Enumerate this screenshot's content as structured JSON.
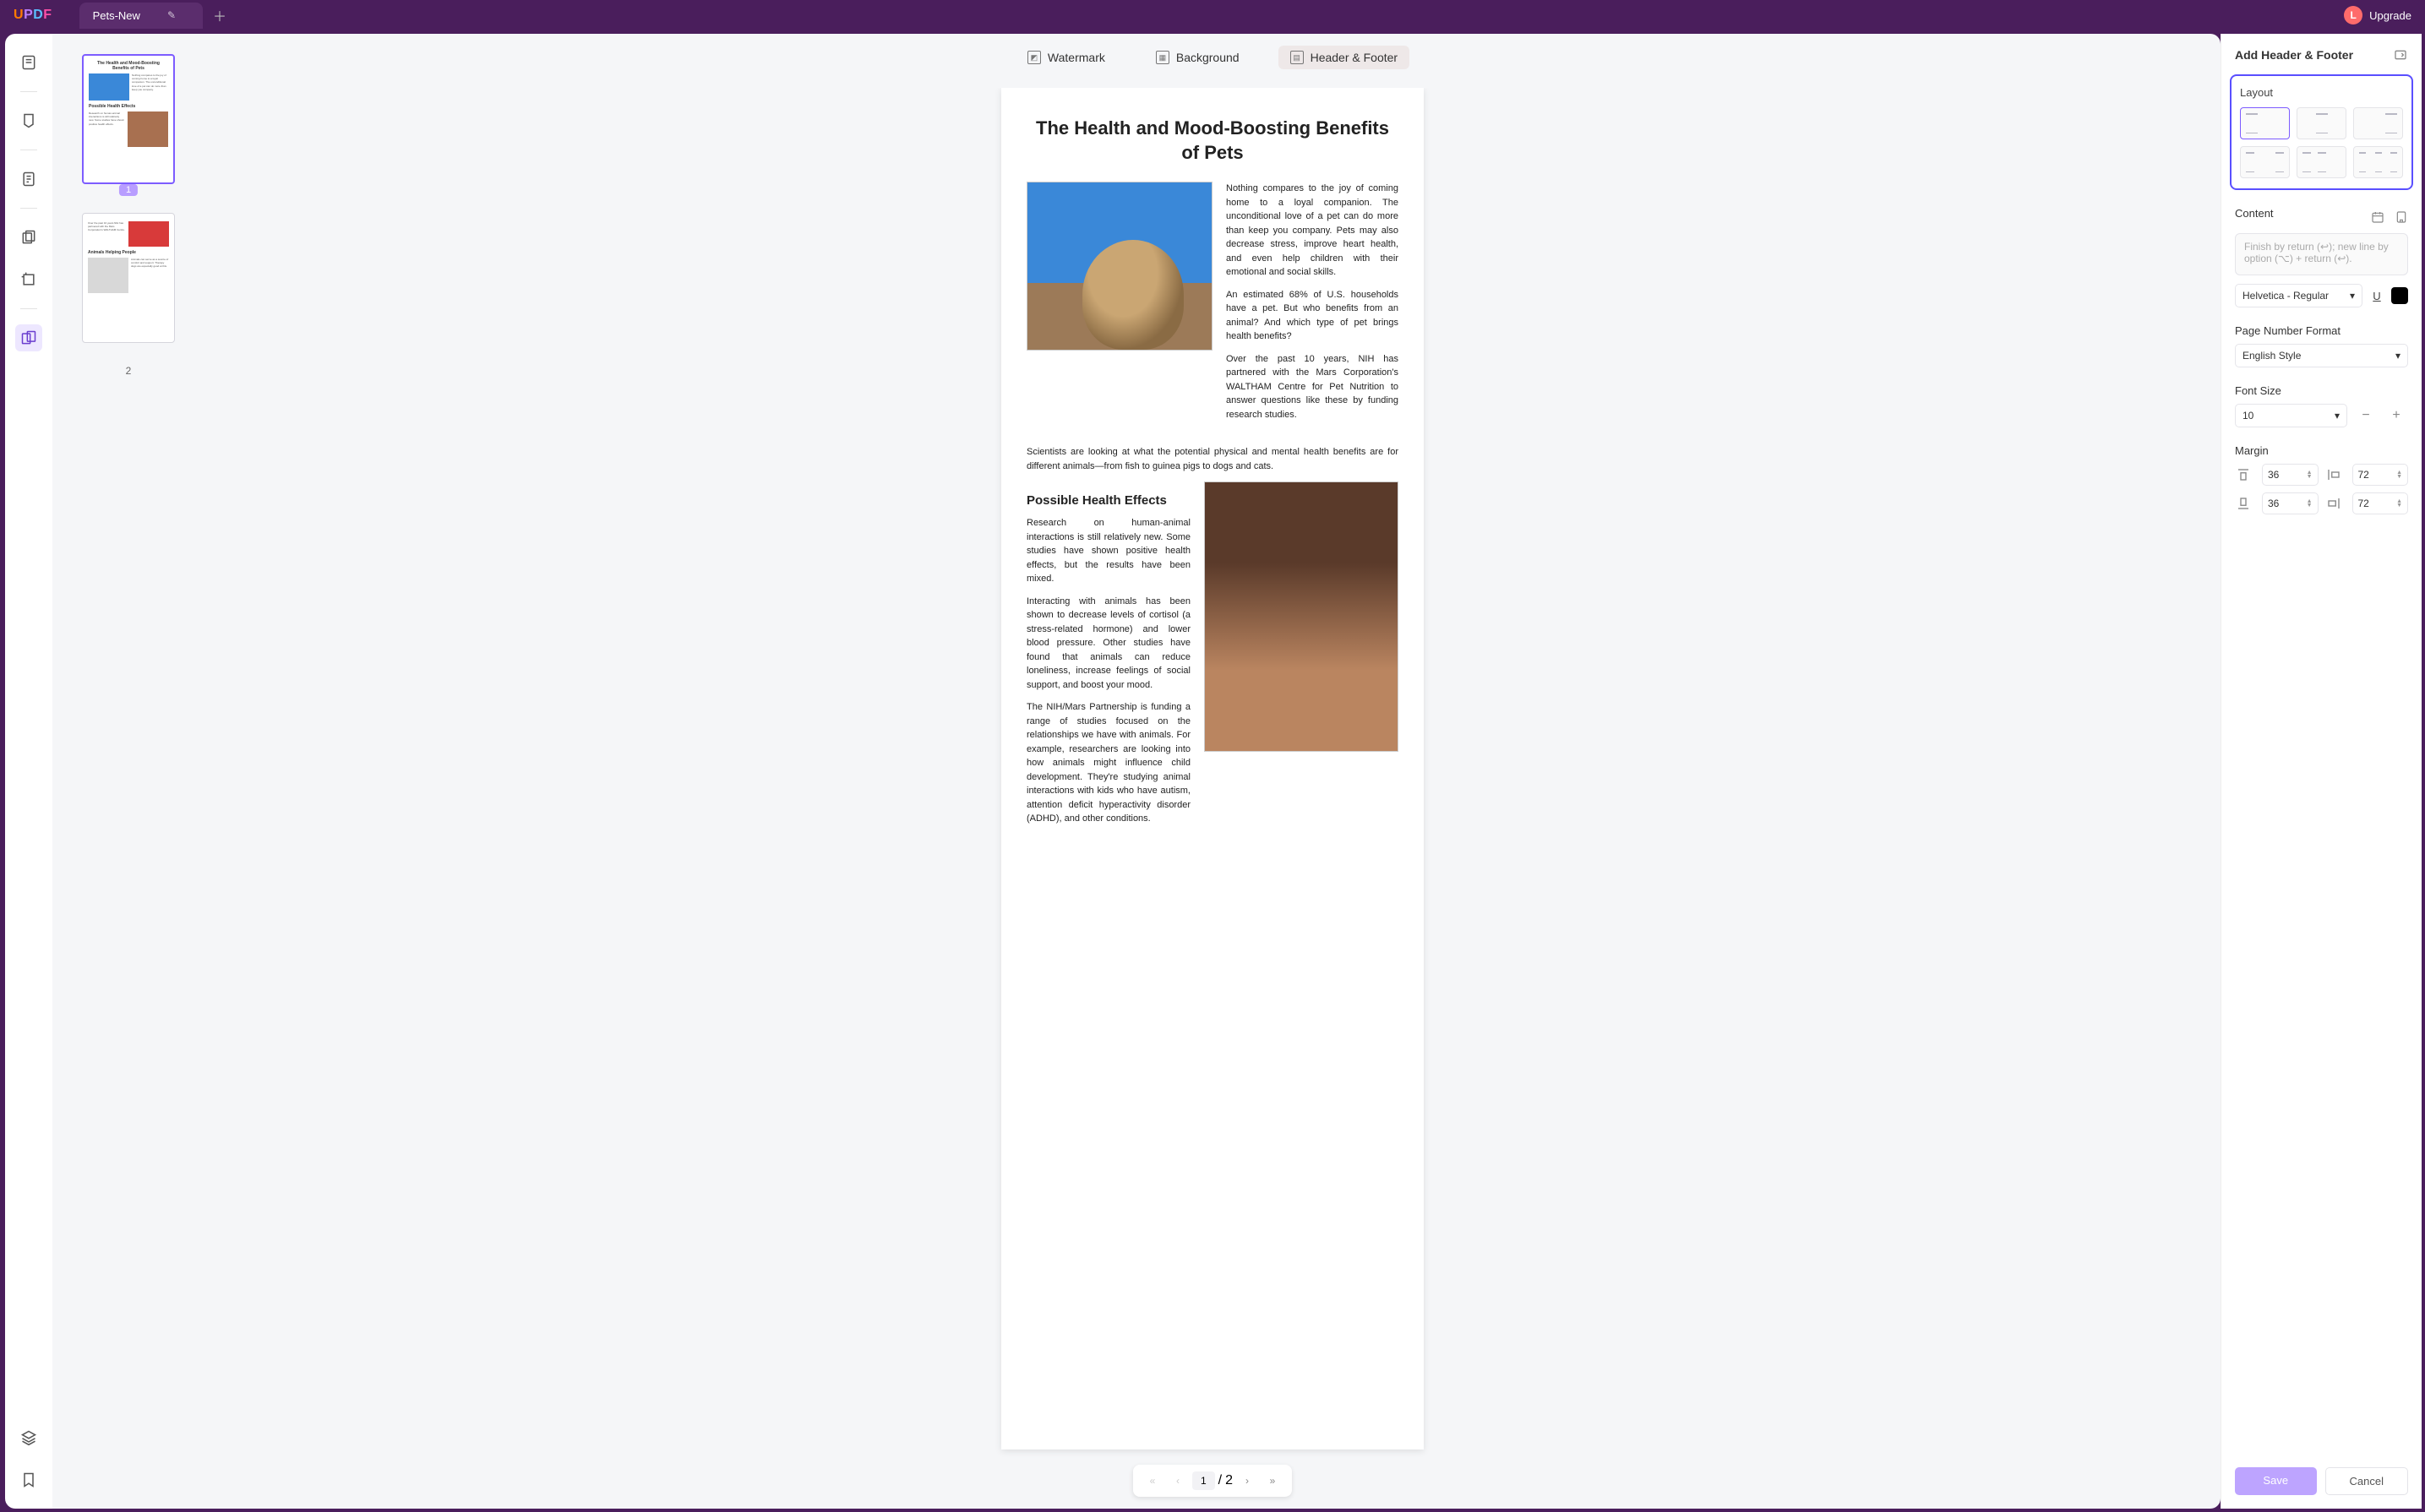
{
  "app": {
    "logo": "UPDF",
    "tab_title": "Pets-New",
    "upgrade": "Upgrade",
    "avatar_letter": "L"
  },
  "top_tabs": {
    "watermark": "Watermark",
    "background": "Background",
    "header_footer": "Header & Footer"
  },
  "document": {
    "title": "The Health and Mood-Boosting Benefits of Pets",
    "p1": "Nothing compares to the joy of coming home to a loyal companion. The unconditional love of a pet can do more than keep you company. Pets may also decrease stress, improve heart health, and even help children with their emotional and social skills.",
    "p2": "An estimated 68% of U.S. households have a pet. But who benefits from an animal? And which type of pet brings health benefits?",
    "p3": "Over the past 10 years, NIH has partnered with the Mars Corporation's WALTHAM Centre for Pet Nutrition to answer questions like these by funding research studies.",
    "mid": "Scientists are looking at what the potential physical and mental health benefits are for different animals—from fish to guinea pigs to dogs and cats.",
    "h2": "Possible Health Effects",
    "p4": "Research on human-animal interactions is still relatively new. Some studies have shown positive health effects, but the results have been mixed.",
    "p5": "Interacting with animals has been shown to decrease levels of cortisol (a stress-related hormone) and lower blood pressure. Other studies have found that animals can reduce loneliness, increase feelings of social support, and boost your mood.",
    "p6": "The NIH/Mars Partnership is funding a range of studies focused on the relationships we have with animals. For example, researchers are looking into how animals might influence child development. They're studying animal interactions with kids who have autism, attention deficit hyperactivity disorder (ADHD), and other conditions."
  },
  "page_nav": {
    "current": "1",
    "sep": "/",
    "total": "2"
  },
  "thumbs": {
    "t1": "1",
    "t2": "2"
  },
  "panel": {
    "title": "Add Header & Footer",
    "layout": "Layout",
    "content": "Content",
    "content_placeholder": "Finish by return (↩); new line by option (⌥) + return (↩).",
    "font": "Helvetica - Regular",
    "page_num_format_label": "Page Number Format",
    "page_num_format": "English Style",
    "font_size_label": "Font Size",
    "font_size": "10",
    "margin_label": "Margin",
    "margin_top": "36",
    "margin_bottom": "36",
    "margin_left": "72",
    "margin_right": "72",
    "save": "Save",
    "cancel": "Cancel"
  }
}
